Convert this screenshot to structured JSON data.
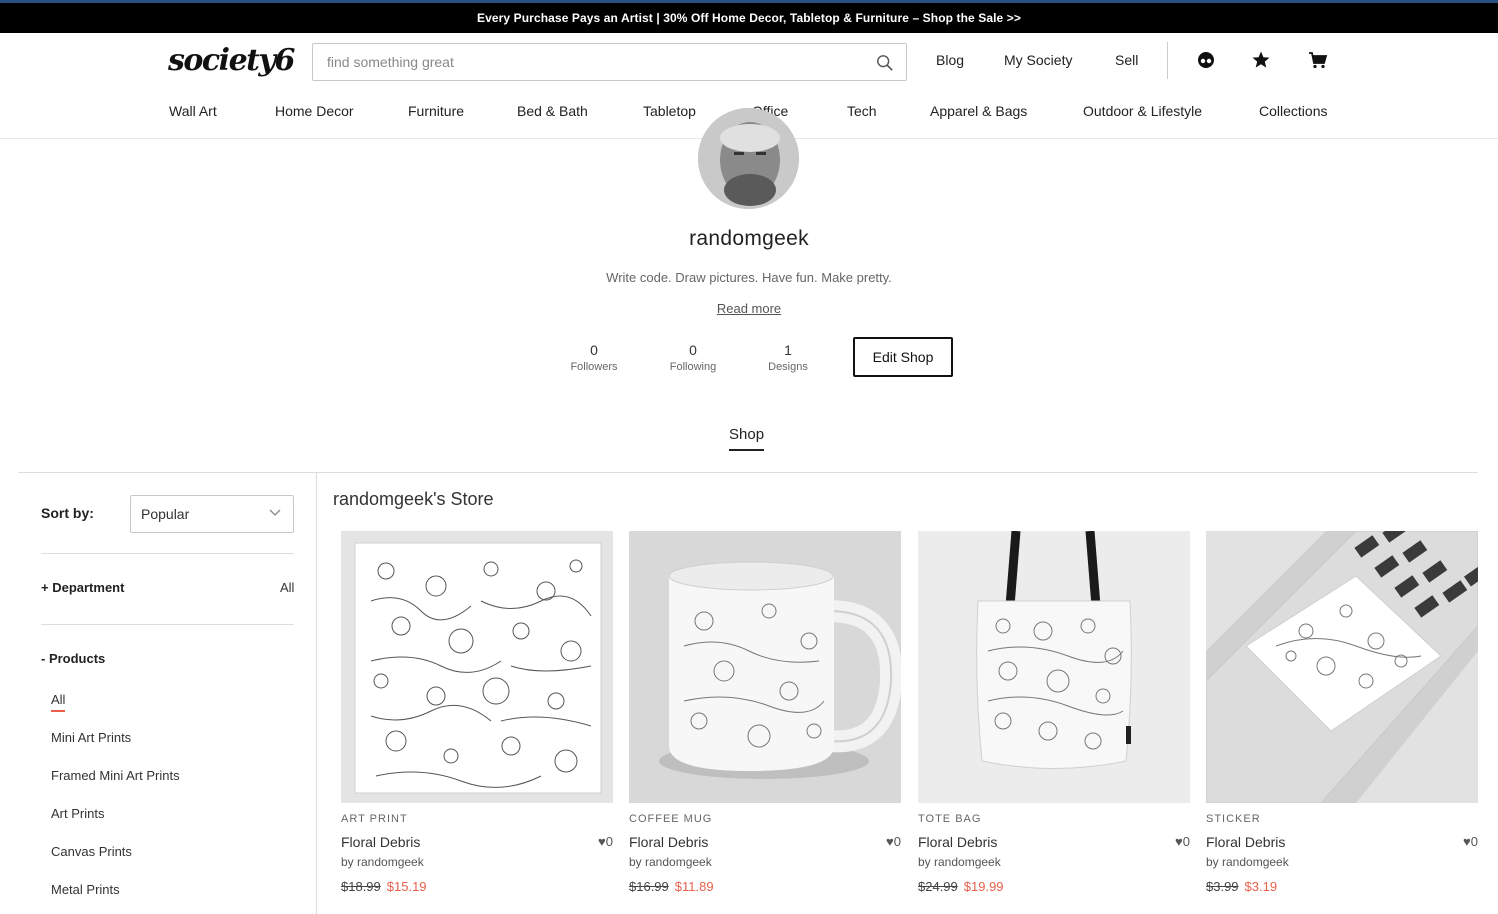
{
  "promo": {
    "text": "Every Purchase Pays an Artist | 30% Off Home Decor, Tabletop & Furniture – Shop the Sale >>"
  },
  "header": {
    "logo": "society6",
    "search_placeholder": "find something great",
    "links": {
      "blog": "Blog",
      "my_society": "My Society",
      "sell": "Sell"
    },
    "icons": [
      "account-icon",
      "star-icon",
      "cart-icon"
    ]
  },
  "categories": [
    "Wall Art",
    "Home Decor",
    "Furniture",
    "Bed & Bath",
    "Tabletop",
    "Office",
    "Tech",
    "Apparel & Bags",
    "Outdoor & Lifestyle",
    "Collections"
  ],
  "profile": {
    "username": "randomgeek",
    "bio": "Write code. Draw pictures. Have fun. Make pretty.",
    "read_more": "Read more",
    "stats": [
      {
        "num": "0",
        "label": "Followers"
      },
      {
        "num": "0",
        "label": "Following"
      },
      {
        "num": "1",
        "label": "Designs"
      }
    ],
    "edit_shop": "Edit Shop"
  },
  "tabs": {
    "shop": "Shop"
  },
  "sidebar": {
    "sort_label": "Sort by:",
    "sort_value": "Popular",
    "department_label": "+ Department",
    "department_value": "All",
    "products_label": "- Products",
    "products": [
      "All",
      "Mini Art Prints",
      "Framed Mini Art Prints",
      "Art Prints",
      "Canvas Prints",
      "Metal Prints"
    ]
  },
  "store": {
    "title": "randomgeek's Store",
    "items": [
      {
        "type": "ART PRINT",
        "title": "Floral Debris",
        "by": "by randomgeek",
        "likes": "0",
        "old_price": "$18.99",
        "new_price": "$15.19"
      },
      {
        "type": "COFFEE MUG",
        "title": "Floral Debris",
        "by": "by randomgeek",
        "likes": "0",
        "old_price": "$16.99",
        "new_price": "$11.89"
      },
      {
        "type": "TOTE BAG",
        "title": "Floral Debris",
        "by": "by randomgeek",
        "likes": "0",
        "old_price": "$24.99",
        "new_price": "$19.99"
      },
      {
        "type": "STICKER",
        "title": "Floral Debris",
        "by": "by randomgeek",
        "likes": "0",
        "old_price": "$3.99",
        "new_price": "$3.19"
      }
    ]
  },
  "colors": {
    "accent": "#e8604c",
    "promo_bg": "#000000",
    "top_line": "#2b4f7e"
  }
}
